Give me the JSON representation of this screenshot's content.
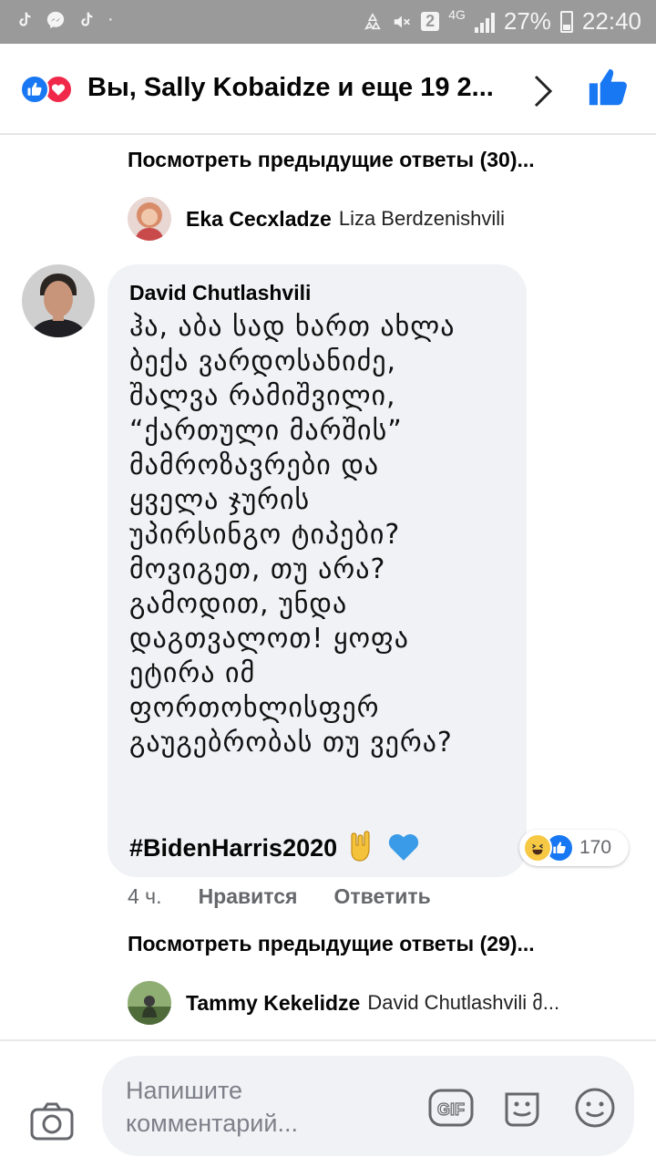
{
  "status_bar": {
    "app_icons": [
      "tiktok-icon",
      "messenger-icon",
      "tiktok-icon"
    ],
    "sim_badge": "2",
    "network": "4G",
    "battery_percent": "27%",
    "time": "22:40"
  },
  "header": {
    "reactions_text": "Вы, Sally Kobaidze и еще 19 2..."
  },
  "thread": {
    "see_previous_top": "Посмотреть предыдущие ответы (30)...",
    "reply_top": {
      "author": "Eka Cecxladze",
      "snippet": "Liza Berdzenishvili"
    },
    "comment": {
      "author": "David Chutlashvili",
      "text": "ჰა, აბა სად ხართ ახლა\nბექა ვარდოსანიძე,\nშალვა რამიშვილი,\n“ქართული მარშის”\nმამროზავრები და\nყველა ჯურის\nუპირსინგო ტიპები?\nმოვიგეთ, თუ არა?\nგამოდით, უნდა\nდაგთვალოთ! ყოფა\nეტირა იმ\nფორთოხლისფერ\nგაუგებრობას თუ ვერა?",
      "hashtag": "#BidenHarris2020",
      "reaction_count": "170",
      "time": "4 ч.",
      "like_label": "Нравится",
      "reply_label": "Ответить"
    },
    "see_previous_bottom": "Посмотреть предыдущие ответы (29)...",
    "reply_bottom": {
      "author": "Tammy Kekelidze",
      "snippet": "David Chutlashvili მ..."
    }
  },
  "composer": {
    "placeholder": "Напишите комментарий...",
    "gif_label": "GIF"
  },
  "colors": {
    "facebook_blue": "#1877f2",
    "love_red": "#f02849",
    "bubble_bg": "#f0f2f5",
    "meta_gray": "#65676b"
  }
}
